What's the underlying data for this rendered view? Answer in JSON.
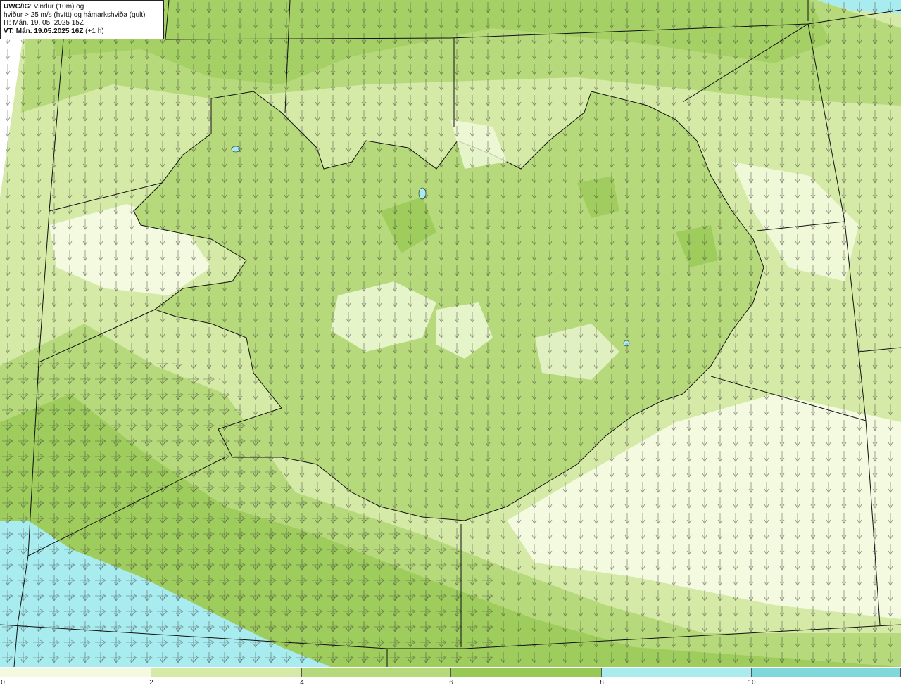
{
  "header": {
    "product": "UWC/IG",
    "title_rest": ": Vindur (10m) og",
    "line2": "hviður > 25 m/s (hvítt) og hámarkshviða (gult)",
    "line3": "IT: Mán. 19. 05. 2025 15Z",
    "vt_label": "VT: Mán. 19.05.2025 16Z",
    "vt_offset": " (+1 h)"
  },
  "colorbar": {
    "bins": [
      {
        "color": "#f3fadf"
      },
      {
        "color": "#d4eaa6"
      },
      {
        "color": "#b6d97b"
      },
      {
        "color": "#98c856"
      },
      {
        "color": "#a9ecef"
      },
      {
        "color": "#80d8dc"
      }
    ],
    "ticks": [
      "0",
      "2",
      "4",
      "6",
      "8",
      "10"
    ]
  },
  "map": {
    "water_color": "#a9ecef",
    "grid_color": "#111111",
    "arrow_color": "#333333"
  }
}
